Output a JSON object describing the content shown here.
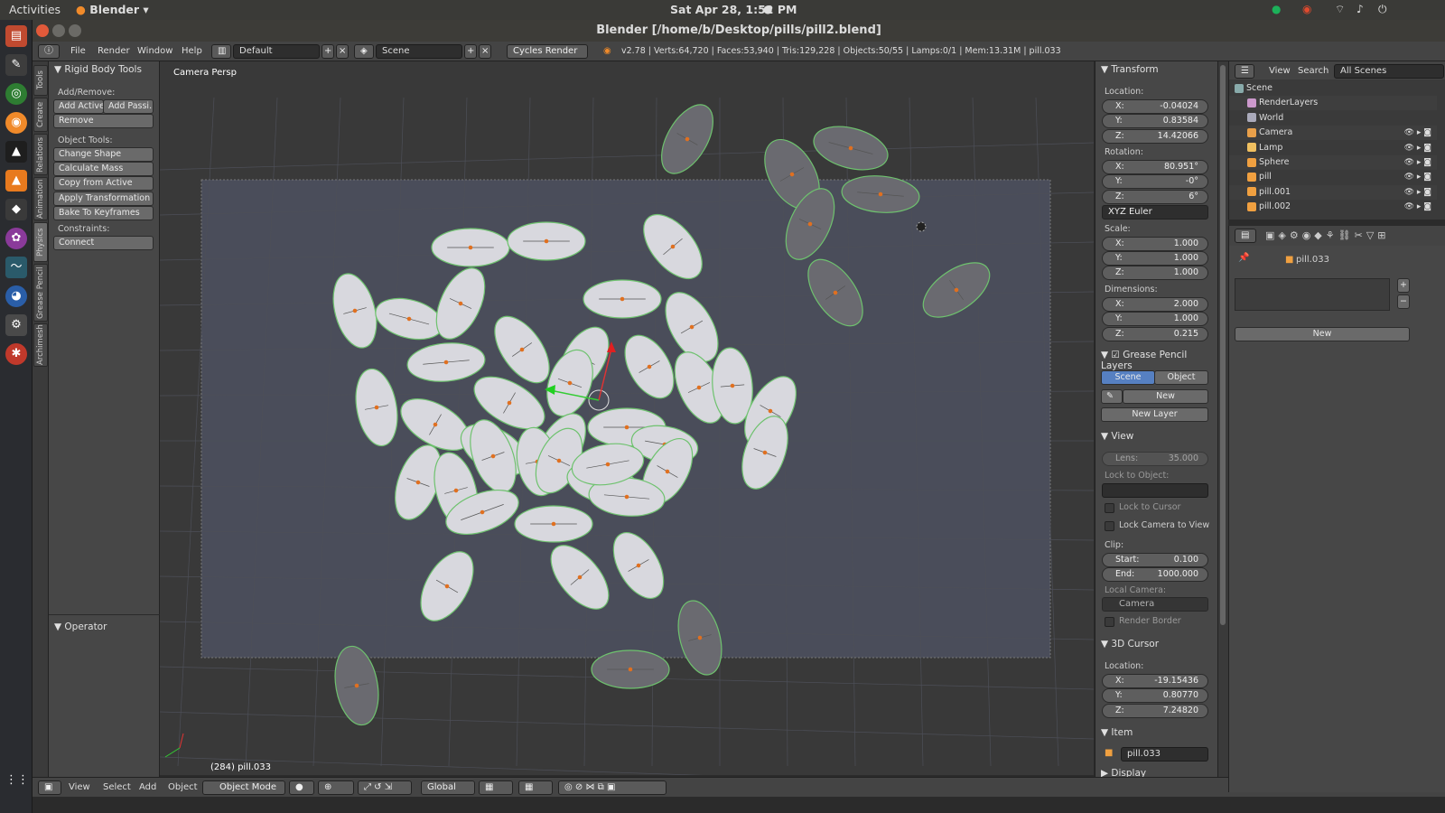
{
  "topbar": {
    "activities": "Activities",
    "app": "Blender",
    "clock": "Sat Apr 28,  1:52 PM"
  },
  "window": {
    "title": "Blender [/home/b/Desktop/pills/pill2.blend]"
  },
  "info_header": {
    "menus": [
      "File",
      "Render",
      "Window",
      "Help"
    ],
    "screen_layout": "Default",
    "scene": "Scene",
    "engine": "Cycles Render",
    "stats": "v2.78 | Verts:64,720 | Faces:53,940 | Tris:129,228 | Objects:50/55 | Lamps:0/1 | Mem:13.31M | pill.033"
  },
  "tool_tabs": [
    "Tools",
    "Create",
    "Relations",
    "Animation",
    "Physics",
    "Grease Pencil",
    "Archimesh"
  ],
  "toolshelf": {
    "panel_title": "Rigid Body Tools",
    "add_remove_label": "Add/Remove:",
    "add_active": "Add Active",
    "add_passive": "Add Passi...",
    "remove": "Remove",
    "object_tools_label": "Object Tools:",
    "change_shape": "Change Shape",
    "calculate_mass": "Calculate Mass",
    "copy_from_active": "Copy from Active",
    "apply_transformation": "Apply Transformation",
    "bake_to_keyframes": "Bake To Keyframes",
    "constraints_label": "Constraints:",
    "connect": "Connect",
    "operator_title": "Operator"
  },
  "viewport": {
    "view_name": "Camera Persp",
    "frame_label": "(284) pill.033"
  },
  "viewport_header": {
    "menus": [
      "View",
      "Select",
      "Add",
      "Object"
    ],
    "mode": "Object Mode",
    "orientation": "Global"
  },
  "npanel": {
    "transform_title": "Transform",
    "location_label": "Location:",
    "location": [
      {
        "k": "X:",
        "v": "-0.04024"
      },
      {
        "k": "Y:",
        "v": "0.83584"
      },
      {
        "k": "Z:",
        "v": "14.42066"
      }
    ],
    "rotation_label": "Rotation:",
    "rotation": [
      {
        "k": "X:",
        "v": "80.951°"
      },
      {
        "k": "Y:",
        "v": "-0°"
      },
      {
        "k": "Z:",
        "v": "6°"
      }
    ],
    "rotation_mode": "XYZ Euler",
    "scale_label": "Scale:",
    "scale": [
      {
        "k": "X:",
        "v": "1.000"
      },
      {
        "k": "Y:",
        "v": "1.000"
      },
      {
        "k": "Z:",
        "v": "1.000"
      }
    ],
    "dimensions_label": "Dimensions:",
    "dimensions": [
      {
        "k": "X:",
        "v": "2.000"
      },
      {
        "k": "Y:",
        "v": "1.000"
      },
      {
        "k": "Z:",
        "v": "0.215"
      }
    ],
    "grease_title": "Grease Pencil Layers",
    "gp_scene": "Scene",
    "gp_object": "Object",
    "gp_new": "New",
    "gp_new_layer": "New Layer",
    "view_title": "View",
    "lens_label": "Lens:",
    "lens_value": "35.000",
    "lock_to_object": "Lock to Object:",
    "lock_to_cursor": "Lock to Cursor",
    "lock_camera": "Lock Camera to View",
    "clip_label": "Clip:",
    "clip_start_k": "Start:",
    "clip_start_v": "0.100",
    "clip_end_k": "End:",
    "clip_end_v": "1000.000",
    "local_camera": "Local Camera:",
    "camera_name": "Camera",
    "render_border": "Render Border",
    "cursor_title": "3D Cursor",
    "cursor_location_label": "Location:",
    "cursor_location": [
      {
        "k": "X:",
        "v": "-19.15436"
      },
      {
        "k": "Y:",
        "v": "0.80770"
      },
      {
        "k": "Z:",
        "v": "7.24820"
      }
    ],
    "item_title": "Item",
    "item_name": "pill.033",
    "display_title": "Display"
  },
  "outliner": {
    "view": "View",
    "search": "Search",
    "filter": "All Scenes",
    "items": [
      "Scene",
      "RenderLayers",
      "World",
      "Camera",
      "Lamp",
      "Sphere",
      "pill",
      "pill.001",
      "pill.002"
    ]
  },
  "properties": {
    "object_name": "pill.033",
    "new_button": "New"
  },
  "colors": {
    "accent_blue": "#5680c2",
    "selection_green": "#6ec26e",
    "origin": "#e07020",
    "pill_fill": "#d8d8de"
  }
}
